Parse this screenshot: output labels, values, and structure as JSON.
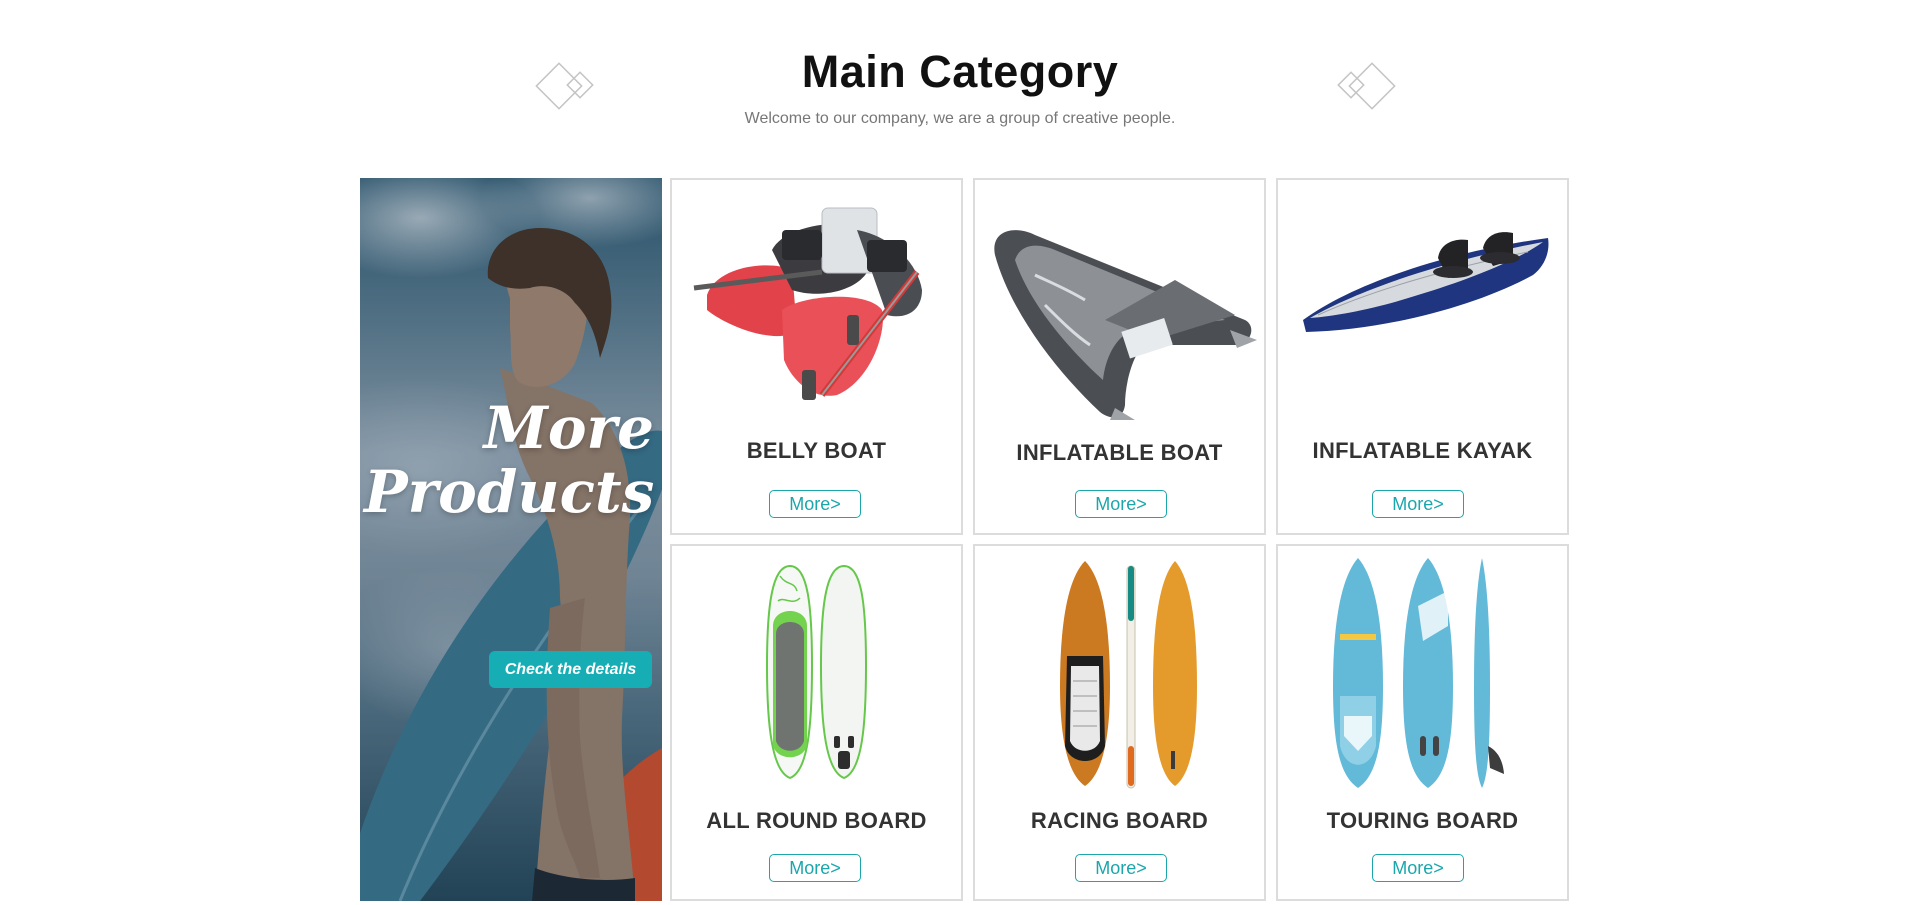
{
  "header": {
    "title": "Main Category",
    "subtitle": "Welcome to our company, we are a group of creative people."
  },
  "promo": {
    "title_line1": "More",
    "title_line2": "Products",
    "button_label": "Check the details"
  },
  "products": [
    {
      "name": "BELLY BOAT",
      "more_label": "More>",
      "icon": "belly-boat-image"
    },
    {
      "name": "INFLATABLE BOAT",
      "more_label": "More>",
      "icon": "inflatable-boat-image"
    },
    {
      "name": "INFLATABLE KAYAK",
      "more_label": "More>",
      "icon": "inflatable-kayak-image"
    },
    {
      "name": "ALL ROUND BOARD",
      "more_label": "More>",
      "icon": "all-round-board-image"
    },
    {
      "name": "RACING BOARD",
      "more_label": "More>",
      "icon": "racing-board-image"
    },
    {
      "name": "TOURING BOARD",
      "more_label": "More>",
      "icon": "touring-board-image"
    }
  ],
  "colors": {
    "accent": "#16aeb4",
    "more_border": "#1ba6ac",
    "card_border": "#dcdcdc",
    "title": "#111111",
    "subtitle": "#777777"
  }
}
